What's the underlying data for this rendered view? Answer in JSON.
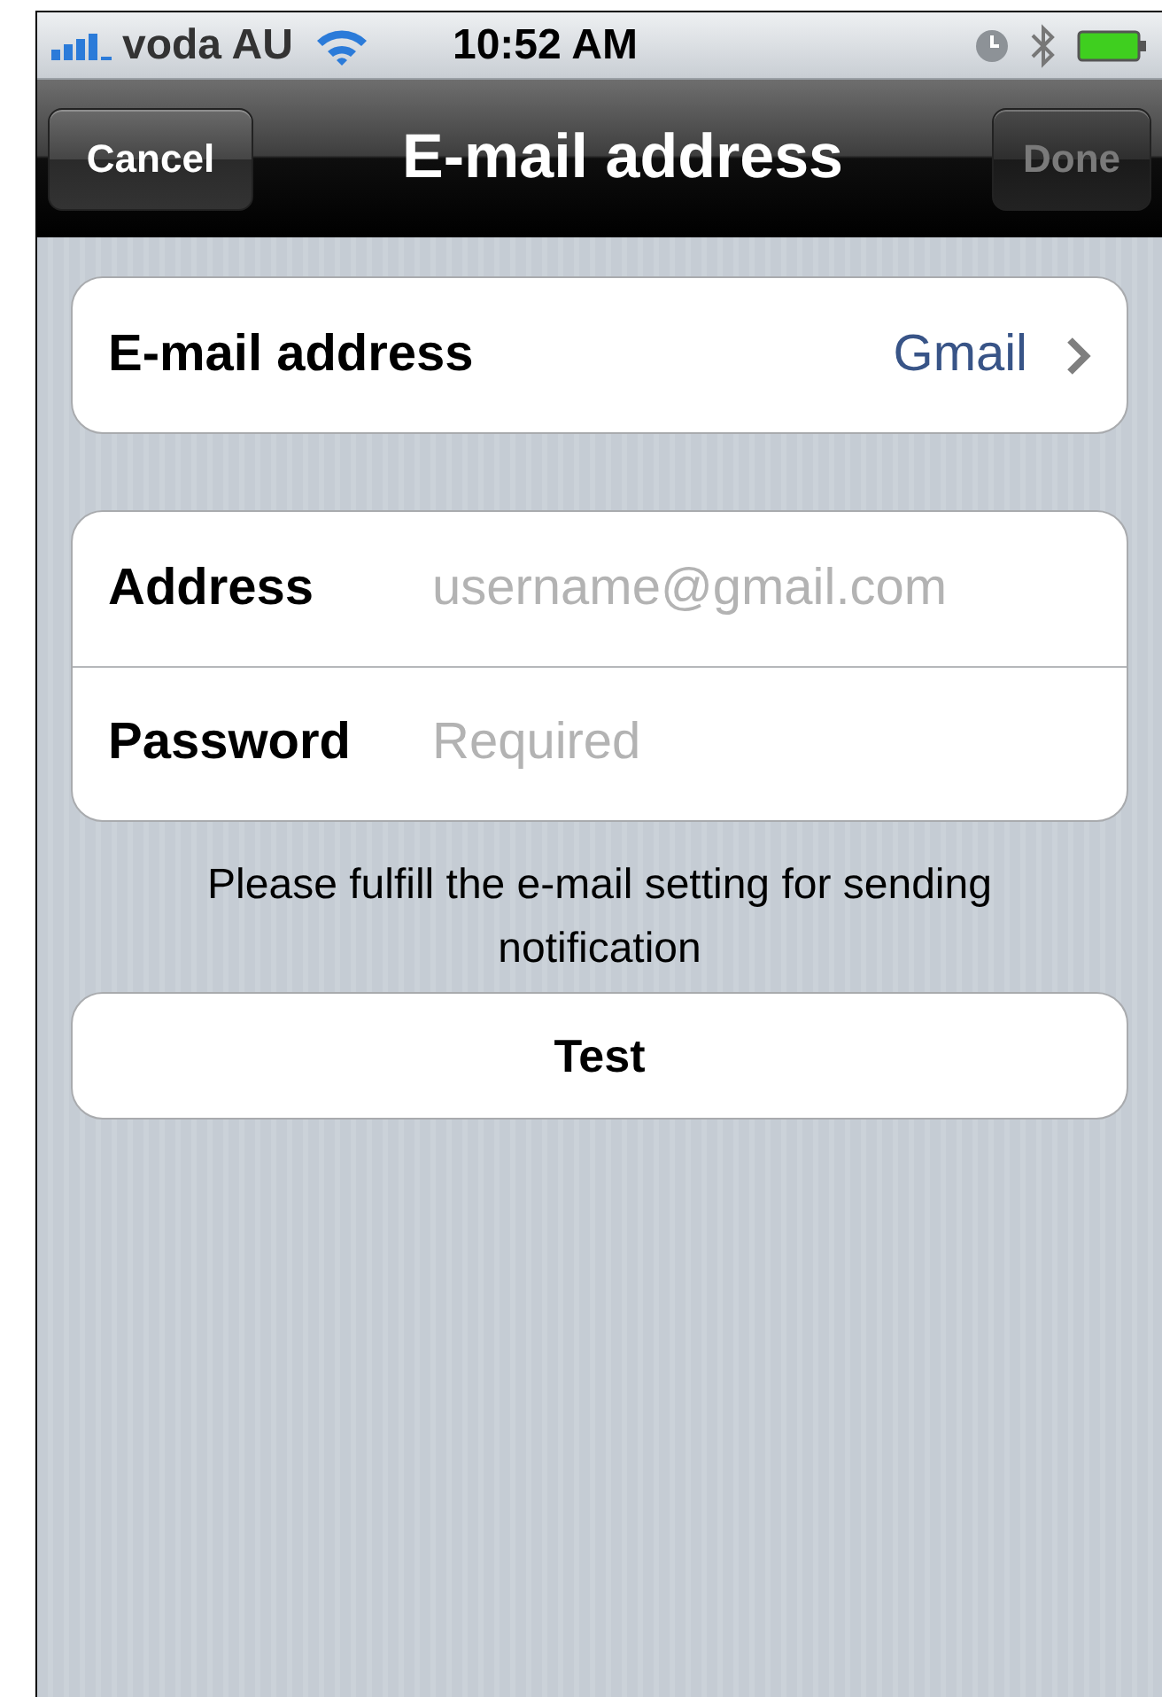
{
  "status_bar": {
    "carrier": "voda AU",
    "time": "10:52 AM"
  },
  "nav_bar": {
    "title": "E-mail address",
    "left_button": {
      "label": "Cancel",
      "disabled": false
    },
    "right_button": {
      "label": "Done",
      "disabled": true
    }
  },
  "account_row": {
    "label": "E-mail address",
    "value": "Gmail"
  },
  "fields": [
    {
      "label": "Address",
      "placeholder": "username@gmail.com"
    },
    {
      "label": "Password",
      "placeholder": "Required"
    }
  ],
  "hint": "Please fulfill the e-mail setting for sending notification",
  "test_button": "Test"
}
